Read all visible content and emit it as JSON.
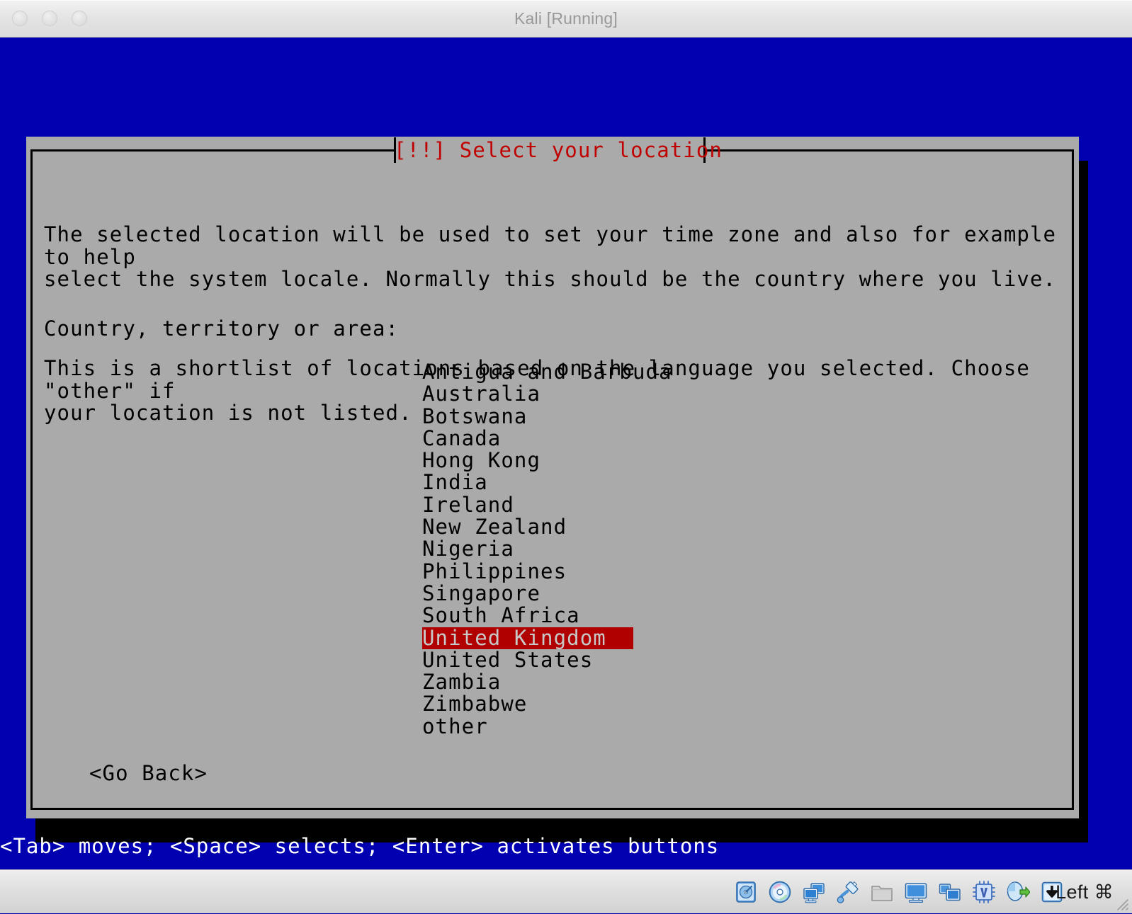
{
  "window": {
    "title": "Kali [Running]",
    "traffic_lights": [
      "close",
      "minimize",
      "zoom"
    ]
  },
  "dialog": {
    "title": "[!!] Select your location",
    "paragraphs": [
      "The selected location will be used to set your time zone and also for example to help\nselect the system locale. Normally this should be the country where you live.",
      "This is a shortlist of locations based on the language you selected. Choose \"other\" if\nyour location is not listed."
    ],
    "field_label": "Country, territory or area:",
    "countries": [
      "Antigua and Barbuda",
      "Australia",
      "Botswana",
      "Canada",
      "Hong Kong",
      "India",
      "Ireland",
      "New Zealand",
      "Nigeria",
      "Philippines",
      "Singapore",
      "South Africa",
      "United Kingdom",
      "United States",
      "Zambia",
      "Zimbabwe",
      "other"
    ],
    "selected_country": "United Kingdom",
    "go_back_label": "<Go Back>",
    "colors": {
      "title": "#c00000",
      "panel": "#aaaaaa",
      "selection_bg": "#b00000",
      "selection_fg": "#c8c8c8",
      "screen_bg": "#0000b0"
    }
  },
  "console": {
    "hint": "<Tab> moves; <Space> selects; <Enter> activates buttons"
  },
  "statusbar": {
    "icons": [
      "hard-disk-icon",
      "optical-disc-icon",
      "network-icon",
      "usb-icon",
      "shared-folder-icon",
      "display-icon",
      "remote-display-icon",
      "virtualization-icon",
      "mouse-integration-icon",
      "host-key-icon"
    ],
    "host_key_label": "Left ⌘"
  }
}
